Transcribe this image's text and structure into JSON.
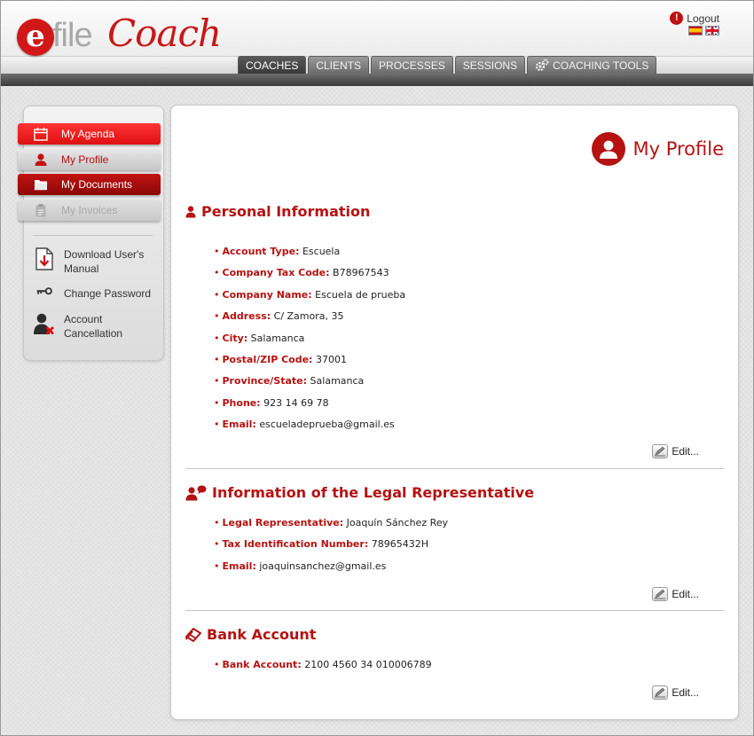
{
  "header": {
    "logo": {
      "e": "e",
      "file": "file",
      "coach": "Coach"
    },
    "logout_label": "Logout",
    "languages": [
      "es",
      "en"
    ],
    "nav": [
      {
        "label": "COACHES",
        "active": true
      },
      {
        "label": "CLIENTS",
        "active": false
      },
      {
        "label": "PROCESSES",
        "active": false
      },
      {
        "label": "SESSIONS",
        "active": false
      },
      {
        "label": "COACHING TOOLS",
        "active": false,
        "icon": "gear-icon"
      }
    ]
  },
  "sidebar": {
    "menu": [
      {
        "label": "My Agenda",
        "icon": "calendar-icon",
        "state": "normal"
      },
      {
        "label": "My Profile",
        "icon": "user-icon",
        "state": "selected"
      },
      {
        "label": "My Documents",
        "icon": "folder-icon",
        "state": "normal"
      },
      {
        "label": "My Invoices",
        "icon": "clipboard-icon",
        "state": "disabled"
      }
    ],
    "links": [
      {
        "label": "Download User's Manual",
        "icon": "pdf-download-icon"
      },
      {
        "label": "Change Password",
        "icon": "key-icon"
      },
      {
        "label": "Account Cancellation",
        "icon": "user-delete-icon"
      }
    ]
  },
  "main": {
    "page_title": "My Profile",
    "edit_label": "Edit...",
    "personal": {
      "title": "Personal Information",
      "fields": [
        {
          "key": "Account Type:",
          "value": "Escuela"
        },
        {
          "key": "Company Tax Code:",
          "value": "B78967543"
        },
        {
          "key": "Company Name:",
          "value": "Escuela de prueba"
        },
        {
          "key": "Address:",
          "value": "C/ Zamora, 35"
        },
        {
          "key": "City:",
          "value": "Salamanca"
        },
        {
          "key": "Postal/ZIP Code:",
          "value": "37001"
        },
        {
          "key": "Province/State:",
          "value": "Salamanca"
        },
        {
          "key": "Phone:",
          "value": "923 14 69 78"
        },
        {
          "key": "Email:",
          "value": "escueladeprueba@gmail.es"
        }
      ]
    },
    "legal": {
      "title": "Information of the Legal Representative",
      "fields": [
        {
          "key": "Legal Representative:",
          "value": "Joaquín Sánchez Rey"
        },
        {
          "key": "Tax Identification Number:",
          "value": "78965432H"
        },
        {
          "key": "Email:",
          "value": "joaquinsanchez@gmail.es"
        }
      ]
    },
    "bank": {
      "title": "Bank Account",
      "fields": [
        {
          "key": "Bank Account:",
          "value": "2100 4560 34 010006789"
        }
      ]
    }
  },
  "colors": {
    "brand_red": "#b51212",
    "menu_red": "#ee2222",
    "menu_dark_red": "#a80c0c"
  }
}
